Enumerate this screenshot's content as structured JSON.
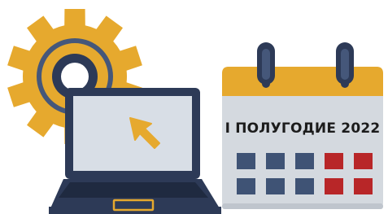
{
  "calendar": {
    "title": "I ПОЛУГОДИЕ 2022"
  },
  "icons": {
    "gear": "gear-icon",
    "laptop": "laptop-icon",
    "cursor": "cursor-arrow-icon",
    "calendar": "calendar-icon"
  },
  "colors": {
    "gear_fill": "#e6a92e",
    "navy": "#2d3a57",
    "laptop_screen": "#d8dee6",
    "calendar_header": "#e6a92e",
    "calendar_body": "#d4d9df",
    "day_blue": "#3f5375",
    "day_red": "#b82628",
    "cursor": "#e6a92e"
  }
}
